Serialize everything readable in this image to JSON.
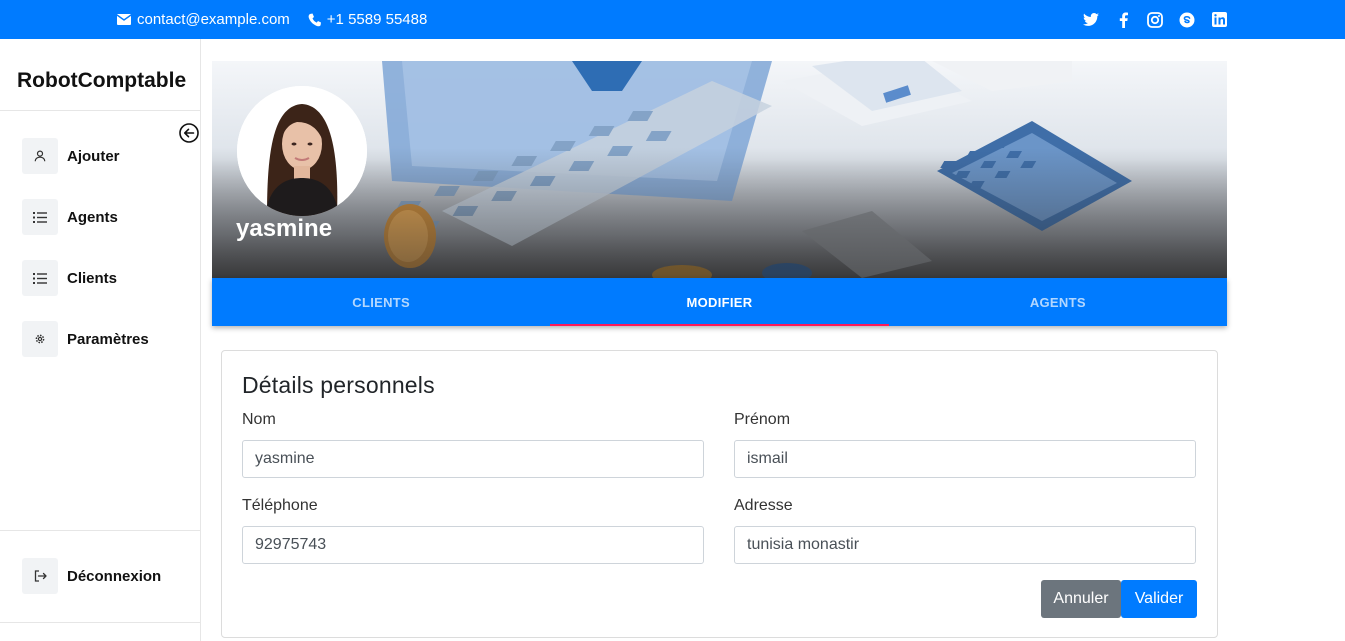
{
  "topbar": {
    "email": "contact@example.com",
    "phone": "+1 5589 55488",
    "social": [
      "twitter-icon",
      "facebook-icon",
      "instagram-icon",
      "skype-icon",
      "linkedin-icon"
    ]
  },
  "sidebar": {
    "brand": "RobotComptable",
    "items": [
      {
        "label": "Ajouter",
        "icon": "user-icon"
      },
      {
        "label": "Agents",
        "icon": "list-icon"
      },
      {
        "label": "Clients",
        "icon": "list-icon"
      },
      {
        "label": "Paramètres",
        "icon": "gear-icon"
      }
    ],
    "logout": {
      "label": "Déconnexion",
      "icon": "logout-icon"
    }
  },
  "profile": {
    "name": "yasmine"
  },
  "tabs": [
    {
      "label": "CLIENTS",
      "active": false
    },
    {
      "label": "MODIFIER",
      "active": true
    },
    {
      "label": "AGENTS",
      "active": false
    }
  ],
  "form": {
    "title": "Détails personnels",
    "fields": {
      "nom": {
        "label": "Nom",
        "value": "yasmine"
      },
      "prenom": {
        "label": "Prénom",
        "value": "ismail"
      },
      "telephone": {
        "label": "Téléphone",
        "value": "92975743"
      },
      "adresse": {
        "label": "Adresse",
        "value": "tunisia monastir"
      }
    },
    "cancel_label": "Annuler",
    "submit_label": "Valider"
  },
  "colors": {
    "primary": "#007bff",
    "tab_indicator": "#ff1a5a",
    "cancel": "#6c757d"
  }
}
